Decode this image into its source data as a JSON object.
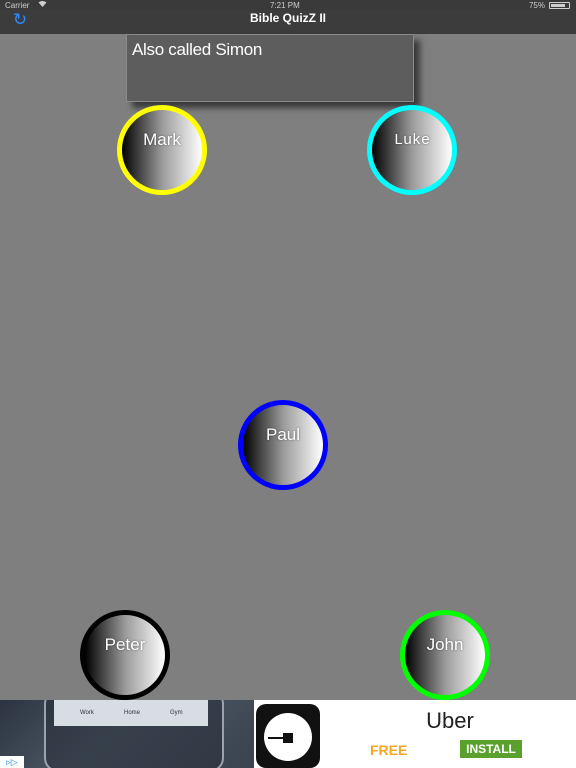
{
  "status_bar": {
    "carrier": "Carrier",
    "wifi_icon": "wifi-icon",
    "time": "7:21 PM",
    "battery": "75%"
  },
  "nav": {
    "title": "Bible QuizZ II",
    "refresh_icon": "↻"
  },
  "question": {
    "text": "Also called Simon"
  },
  "answers": [
    {
      "label": "Mark",
      "ring_color": "#ffff00"
    },
    {
      "label": "Luke",
      "ring_color": "#00ffff"
    },
    {
      "label": "Paul",
      "ring_color": "#0000ff"
    },
    {
      "label": "Peter",
      "ring_color": "#000000"
    },
    {
      "label": "John",
      "ring_color": "#00ff00"
    }
  ],
  "ad": {
    "map_labels": [
      "Work",
      "Home",
      "Gym"
    ],
    "brand": "Uber",
    "free_label": "FREE",
    "install_label": "INSTALL",
    "choices_icon": "▹▷"
  },
  "colors": {
    "background": "#7f7f7f",
    "nav_background": "#3c3c3c",
    "accent": "#2b8cff",
    "install_green": "#5aa02c",
    "free_orange": "#f5a623"
  }
}
